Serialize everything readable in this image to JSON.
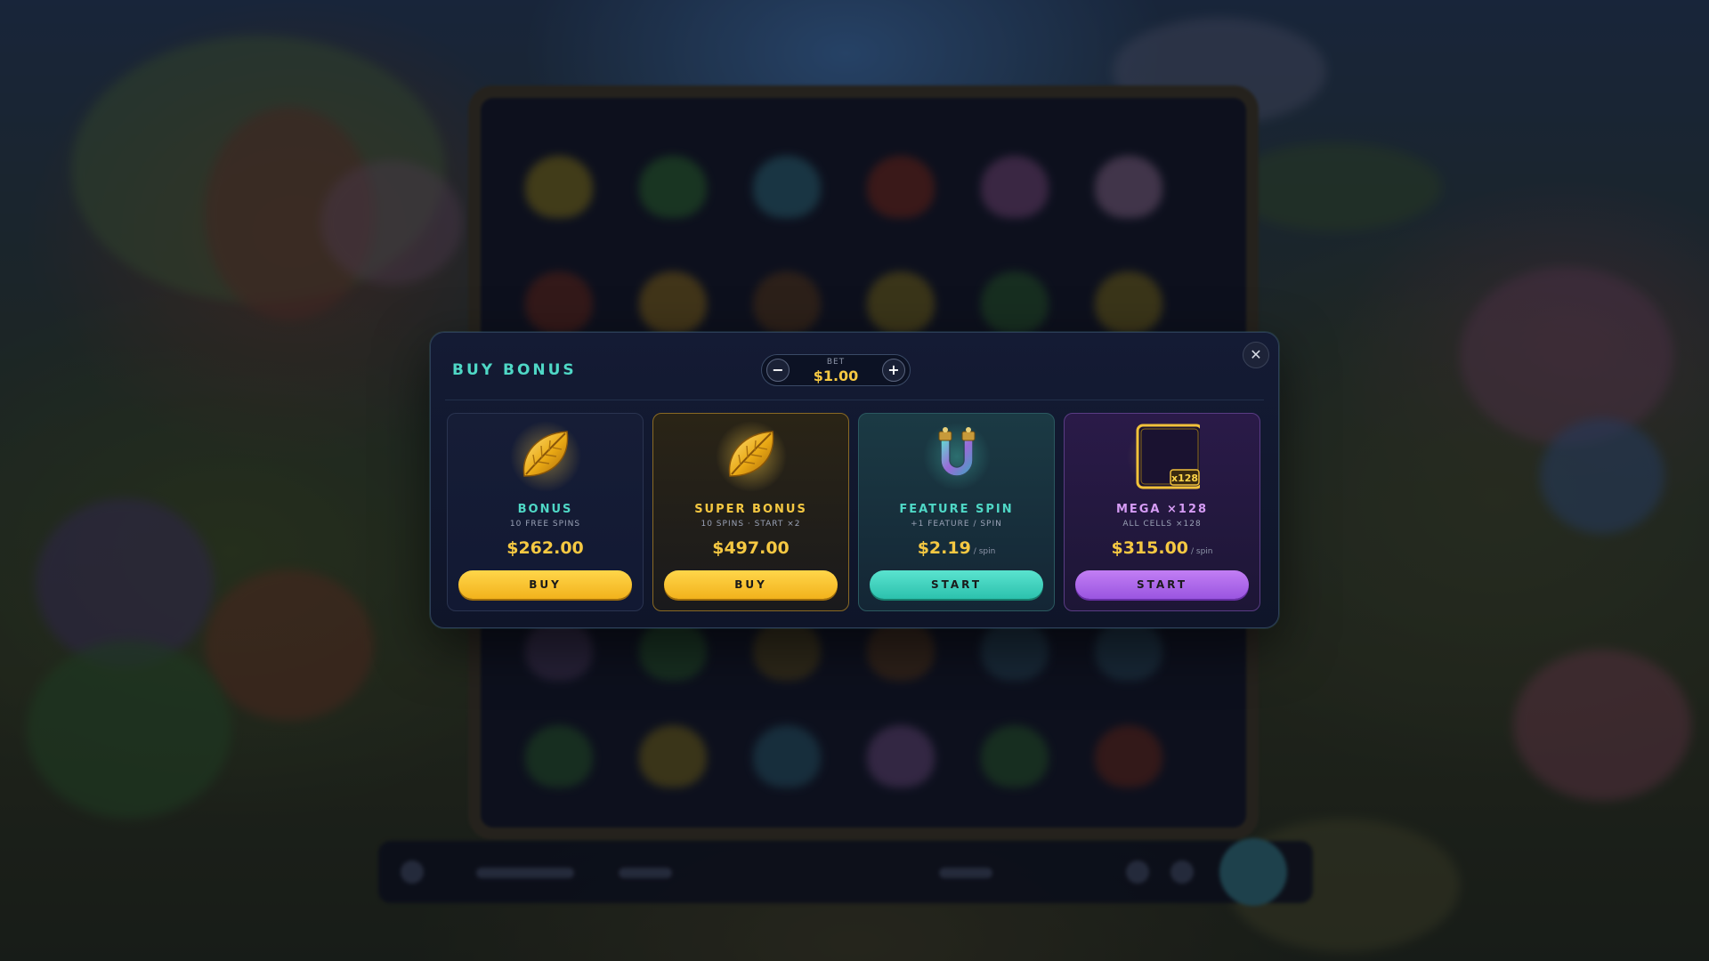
{
  "modal": {
    "title": "BUY BONUS",
    "bet": {
      "label": "BET",
      "value": "$1.00",
      "minus_icon": "minus-icon",
      "plus_icon": "plus-icon"
    },
    "close_icon": "close-icon",
    "cards": [
      {
        "title": "BONUS",
        "subtitle": "10 FREE SPINS",
        "price": "$262.00",
        "unit": "",
        "button": "BUY",
        "icon": "golden-leaf-icon",
        "accent": "#4fd8c6"
      },
      {
        "title": "SUPER BONUS",
        "subtitle": "10 SPINS · START ×2",
        "price": "$497.00",
        "unit": "",
        "button": "BUY",
        "icon": "golden-leaf-icon",
        "accent": "#f5c842"
      },
      {
        "title": "FEATURE SPIN",
        "subtitle": "+1 FEATURE / SPIN",
        "price": "$2.19",
        "unit": "/ spin",
        "button": "START",
        "icon": "magnet-icon",
        "accent": "#4fd8c6"
      },
      {
        "title": "MEGA ×128",
        "subtitle": "ALL CELLS ×128",
        "price": "$315.00",
        "unit": "/ spin",
        "button": "START",
        "icon": "golden-frame-icon",
        "badge": "x128",
        "accent": "#d69cf5"
      }
    ]
  },
  "colors": {
    "teal": "#4fd8c6",
    "gold": "#f5c842",
    "purple": "#b06ee8",
    "modal_bg": "#141b34"
  }
}
